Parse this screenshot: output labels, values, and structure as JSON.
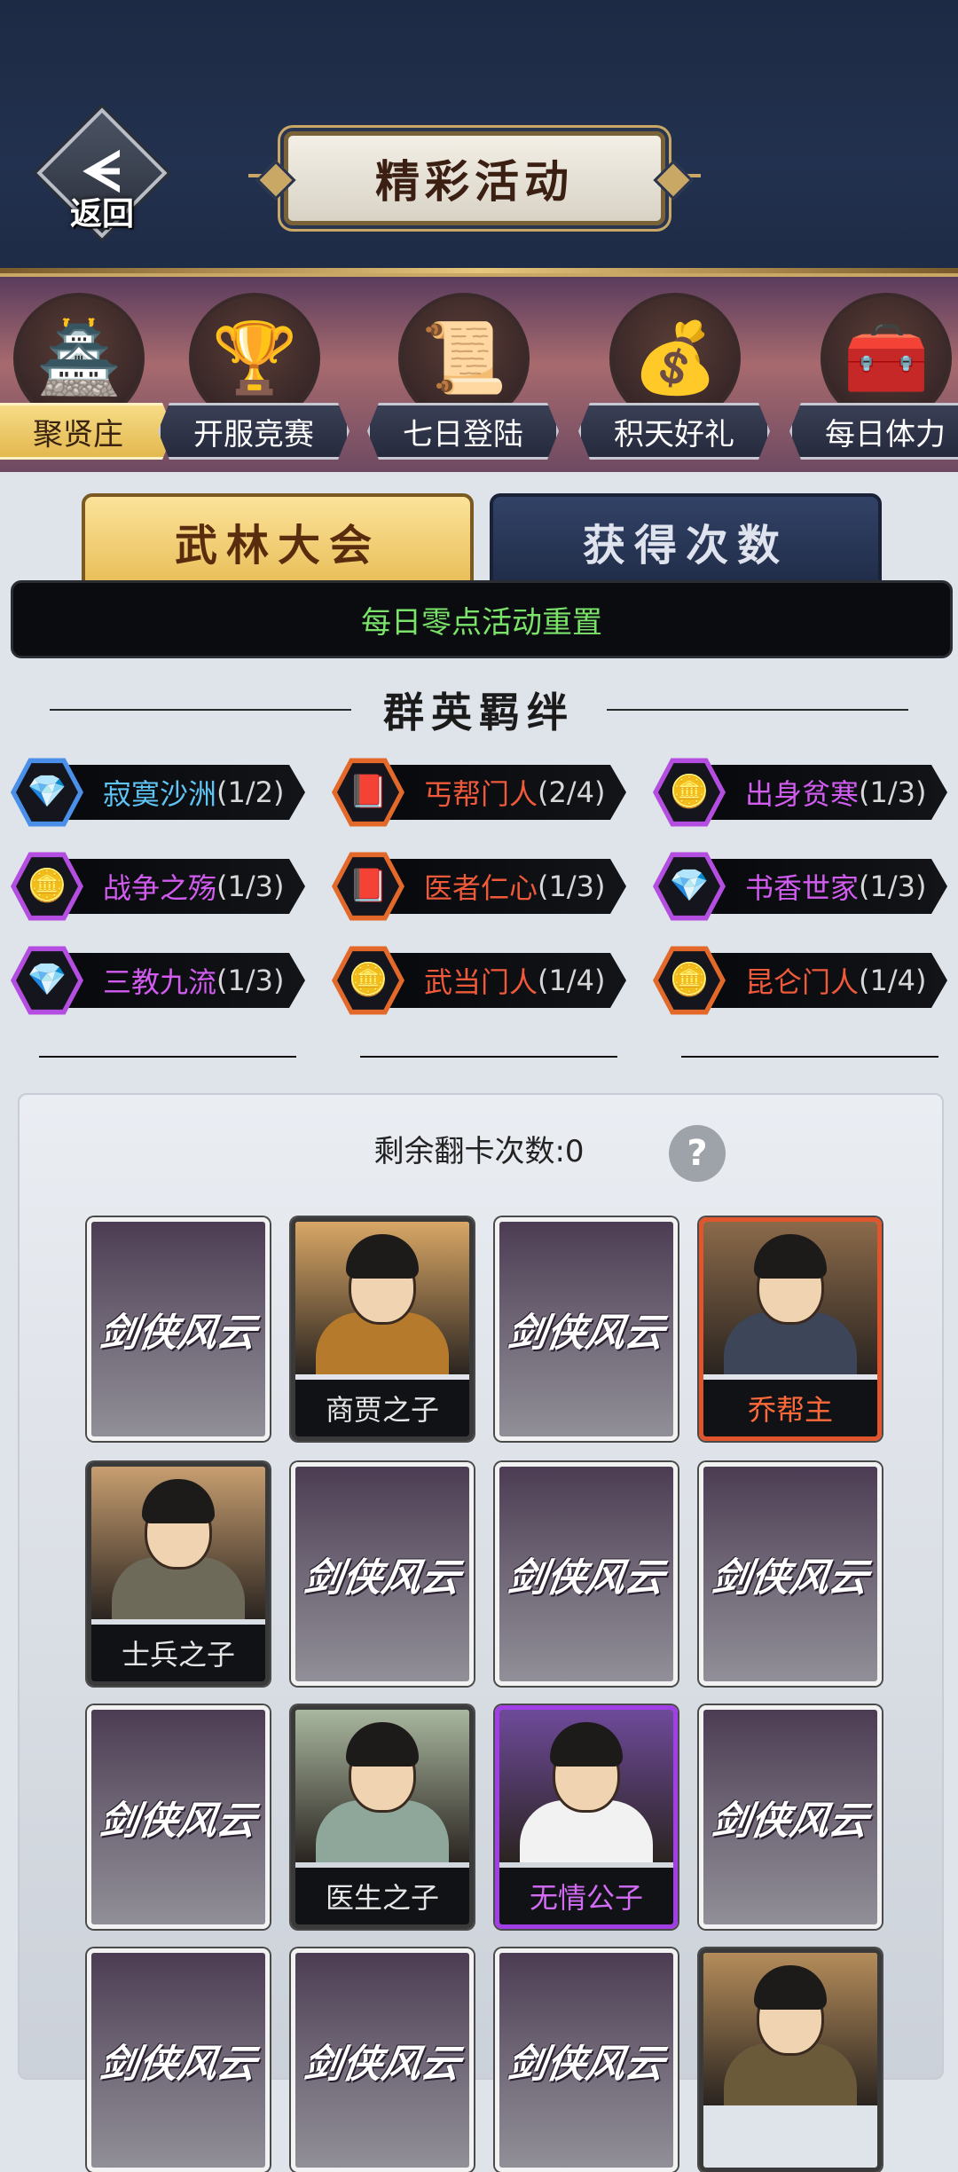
{
  "header": {
    "back_label": "返回",
    "back_glyph": "ᗕ",
    "title": "精彩活动"
  },
  "events": [
    {
      "label": "聚贤庄",
      "icon": "palace-icon",
      "glyph": "🏯",
      "active": true
    },
    {
      "label": "开服竞赛",
      "icon": "trophy-icon",
      "glyph": "🏆",
      "active": false
    },
    {
      "label": "七日登陆",
      "icon": "scroll-gold-icon",
      "glyph": "📜",
      "active": false
    },
    {
      "label": "积天好礼",
      "icon": "money-bag-icon",
      "glyph": "💰",
      "active": false
    },
    {
      "label": "每日体力",
      "icon": "chest-icon",
      "glyph": "🧰",
      "active": false
    }
  ],
  "sub_tabs": {
    "left": "武林大会",
    "right": "获得次数"
  },
  "notice": "每日零点活动重置",
  "bonds_title": "群英羁绊",
  "bonds": [
    {
      "name": "寂寞沙洲",
      "count": "(1/2)",
      "color": "blue",
      "glyph": "💎"
    },
    {
      "name": "丐帮门人",
      "count": "(2/4)",
      "color": "orange",
      "glyph": "📕"
    },
    {
      "name": "出身贫寒",
      "count": "(1/3)",
      "color": "purple",
      "glyph": "🪙"
    },
    {
      "name": "战争之殇",
      "count": "(1/3)",
      "color": "purple",
      "glyph": "🪙"
    },
    {
      "name": "医者仁心",
      "count": "(1/3)",
      "color": "orange",
      "glyph": "📕"
    },
    {
      "name": "书香世家",
      "count": "(1/3)",
      "color": "purple",
      "glyph": "💎"
    },
    {
      "name": "三教九流",
      "count": "(1/3)",
      "color": "purple",
      "glyph": "💎"
    },
    {
      "name": "武当门人",
      "count": "(1/4)",
      "color": "orange",
      "glyph": "🪙"
    },
    {
      "name": "昆仑门人",
      "count": "(1/4)",
      "color": "orange",
      "glyph": "🪙"
    }
  ],
  "remaining_label": "剩余翻卡次数:0",
  "help_glyph": "?",
  "card_back_text": "剑侠风云",
  "cards": [
    {
      "revealed": false
    },
    {
      "revealed": true,
      "name": "商贾之子",
      "rarity": "gray",
      "name_color": "#e6e6e6",
      "bg": "#d9a766",
      "body": "#b57a2c"
    },
    {
      "revealed": false
    },
    {
      "revealed": true,
      "name": "乔帮主",
      "rarity": "orange",
      "name_color": "#ff6a3a",
      "bg": "#8b6a4a",
      "body": "#3d4658"
    },
    {
      "revealed": true,
      "name": "士兵之子",
      "rarity": "gray",
      "name_color": "#e6e6e6",
      "bg": "#c79e70",
      "body": "#6e6a5a"
    },
    {
      "revealed": false
    },
    {
      "revealed": false
    },
    {
      "revealed": false
    },
    {
      "revealed": false
    },
    {
      "revealed": true,
      "name": "医生之子",
      "rarity": "gray",
      "name_color": "#e6e6e6",
      "bg": "#a9b79f",
      "body": "#8fa79a"
    },
    {
      "revealed": true,
      "name": "无情公子",
      "rarity": "purple",
      "name_color": "#d36cf5",
      "bg": "#6e4a9a",
      "body": "#f2f2f2"
    },
    {
      "revealed": false
    },
    {
      "revealed": false
    },
    {
      "revealed": false
    },
    {
      "revealed": false
    },
    {
      "revealed": true,
      "name": "",
      "rarity": "gray",
      "name_color": "#e6e6e6",
      "bg": "#b48c5a",
      "body": "#6a5a3a"
    }
  ]
}
